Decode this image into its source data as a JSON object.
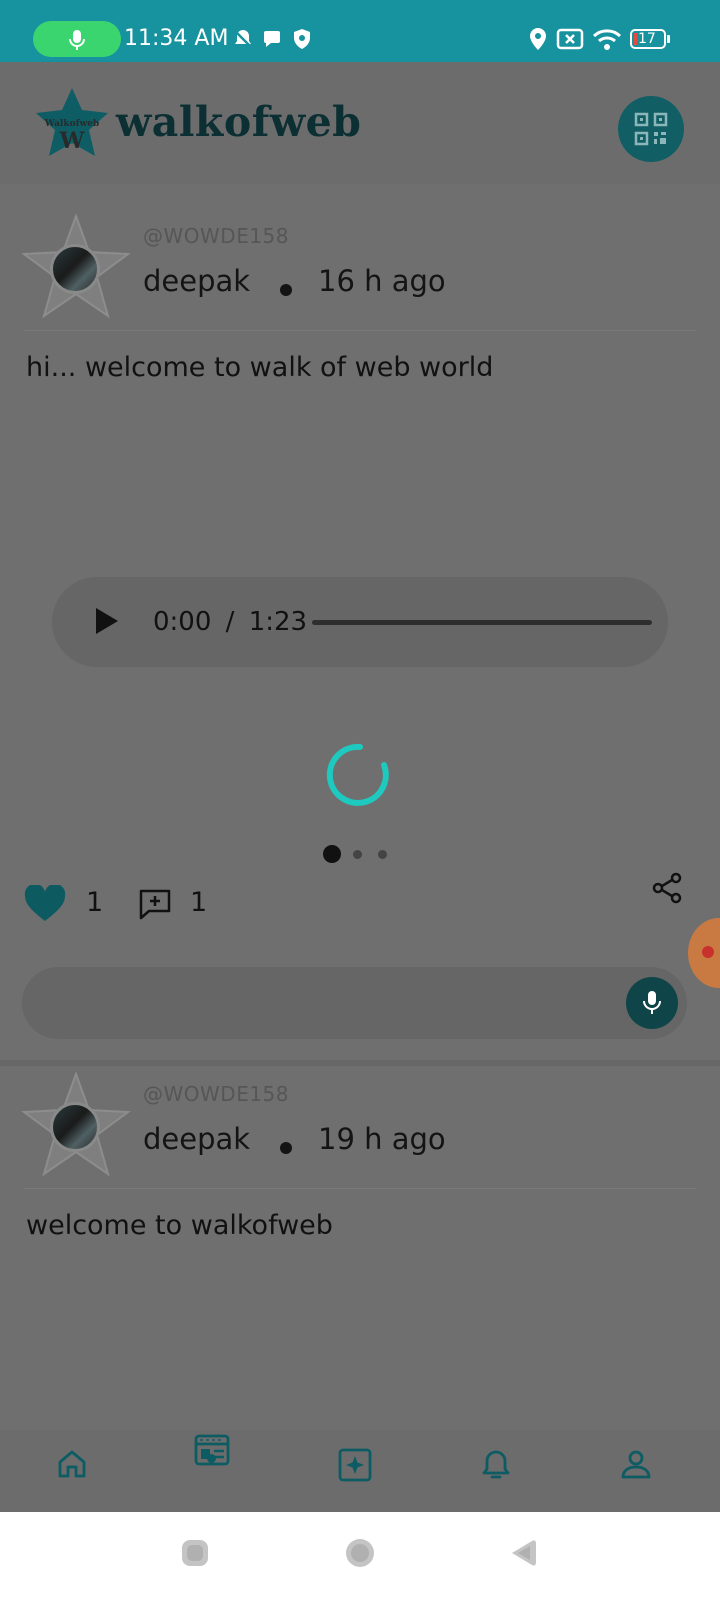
{
  "status_bar": {
    "time": "11:34 AM",
    "battery": "17",
    "icons": [
      "mic-icon",
      "silent-bell-icon",
      "chat-icon",
      "shield-icon",
      "location-icon",
      "no-sim-icon",
      "wifi-icon",
      "battery-icon"
    ]
  },
  "app": {
    "brand": "walkofweb",
    "logo_text": "Walkofweb"
  },
  "posts": [
    {
      "handle": "@WOWDE158",
      "author": "deepak",
      "time_ago": "16 h ago",
      "text": "hi... welcome to walk of web world",
      "audio": {
        "current": "0:00",
        "separator": "/",
        "duration": "1:23"
      },
      "carousel": {
        "count": 3,
        "active": 0
      },
      "likes": "1",
      "comments": "1"
    },
    {
      "handle": "@WOWDE158",
      "author": "deepak",
      "time_ago": "19 h ago",
      "text": "welcome to walkofweb"
    }
  ],
  "bottom_nav": {
    "items": [
      "home-icon",
      "feed-icon",
      "create-post-icon",
      "notifications-icon",
      "profile-icon"
    ],
    "active": 1
  },
  "colors": {
    "status_bar": "#17929f",
    "accent": "#0d5c63",
    "spinner": "#1ec9c0",
    "like": "#0e5a61"
  }
}
